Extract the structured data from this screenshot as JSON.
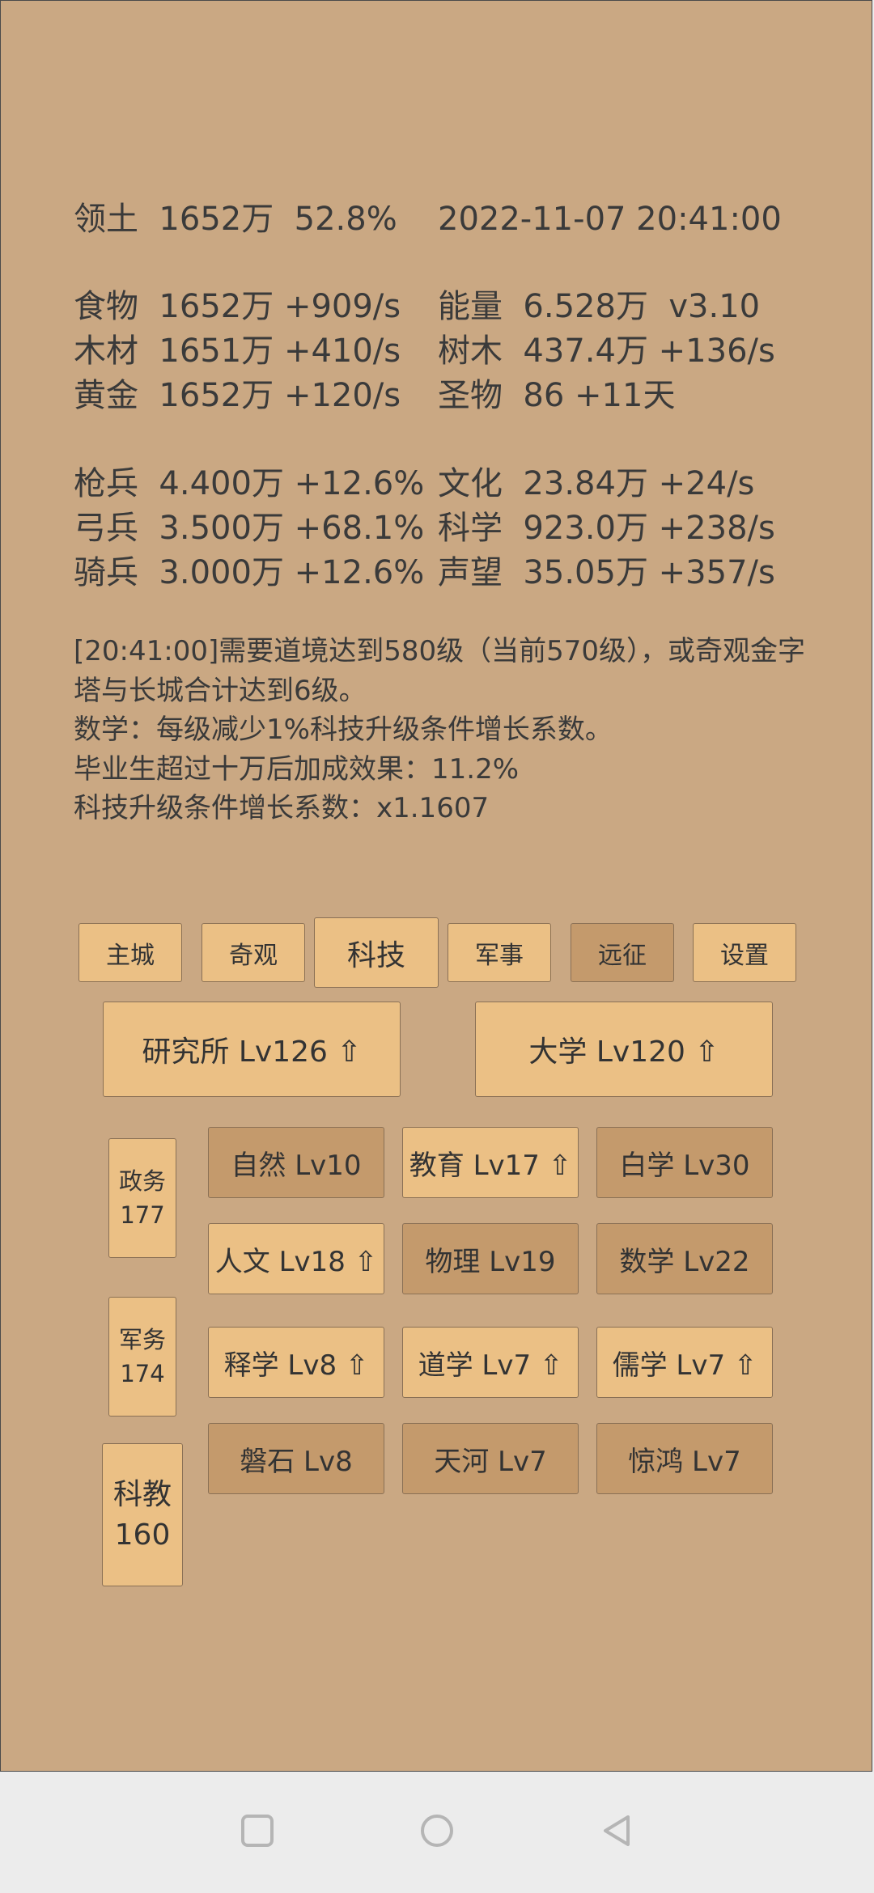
{
  "stats": {
    "territory": "领土  1652万  52.8%",
    "datetime": "2022-11-07 20:41:00",
    "food": "食物  1652万 +909/s",
    "energy": "能量  6.528万  v3.10",
    "wood": "木材  1651万 +410/s",
    "trees": "树木  437.4万 +136/s",
    "gold": "黄金  1652万 +120/s",
    "relics": "圣物  86 +11天",
    "spearmen": "枪兵  4.400万 +12.6%",
    "culture": "文化  23.84万 +24/s",
    "archers": "弓兵  3.500万 +68.1%",
    "science": "科学  923.0万 +238/s",
    "cavalry": "骑兵  3.000万 +12.6%",
    "prestige": "声望  35.05万 +357/s"
  },
  "messages": [
    "[20:41:00]需要道境达到580级（当前570级），或奇观金字",
    "塔与长城合计达到6级。",
    "数学：每级减少1%科技升级条件增长系数。",
    "毕业生超过十万后加成效果：11.2%",
    "科技升级条件增长系数：x1.1607"
  ],
  "tabs": {
    "main_city": "主城",
    "wonders": "奇观",
    "tech": "科技",
    "military": "军事",
    "expedition": "远征",
    "settings": "设置"
  },
  "buildings": {
    "institute": "研究所 Lv126 ⇧",
    "university": "大学 Lv120 ⇧"
  },
  "side": {
    "politics_label": "政务",
    "politics_value": "177",
    "military_label": "军务",
    "military_value": "174",
    "education_label": "科教",
    "education_value": "160"
  },
  "techs": {
    "nature": "自然 Lv10",
    "education": "教育 Lv17 ⇧",
    "baixue": "白学 Lv30",
    "humanities": "人文 Lv18 ⇧",
    "physics": "物理 Lv19",
    "math": "数学 Lv22",
    "buddhism": "释学 Lv8 ⇧",
    "taoism": "道学 Lv7 ⇧",
    "confucianism": "儒学 Lv7 ⇧",
    "panshi": "磐石 Lv8",
    "tianhe": "天河 Lv7",
    "jinghong": "惊鸿 Lv7"
  },
  "colors": {
    "background": "#caa883",
    "button_light": "#ebc085",
    "button_dark": "#c49a6c",
    "text": "#333333"
  },
  "icons": [
    "square-icon",
    "circle-icon",
    "triangle-back-icon"
  ]
}
